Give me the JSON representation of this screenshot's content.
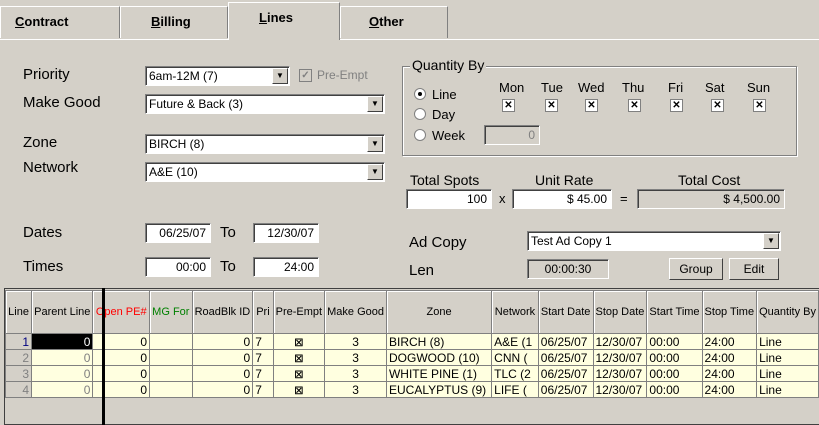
{
  "tabs": [
    {
      "label": "Contract",
      "u": "C",
      "rest": "ontract"
    },
    {
      "label": "Billing",
      "u": "B",
      "rest": "illing"
    },
    {
      "label": "Lines",
      "u": "L",
      "rest": "ines"
    },
    {
      "label": "Other",
      "u": "O",
      "rest": "ther"
    }
  ],
  "form": {
    "priority_label": "Priority",
    "priority_value": "6am-12M (7)",
    "preempt_label": "Pre-Empt",
    "makegood_label": "Make Good",
    "makegood_value": "Future & Back (3)",
    "zone_label": "Zone",
    "zone_value": "BIRCH (8)",
    "network_label": "Network",
    "network_value": "A&E (10)",
    "dates_label": "Dates",
    "date_start": "06/25/07",
    "to1": "To",
    "date_end": "12/30/07",
    "times_label": "Times",
    "time_start": "00:00",
    "to2": "To",
    "time_end": "24:00"
  },
  "quantity": {
    "title": "Quantity By",
    "options": [
      "Line",
      "Day",
      "Week"
    ],
    "selected": "Line",
    "days": [
      "Mon",
      "Tue",
      "Wed",
      "Thu",
      "Fri",
      "Sat",
      "Sun"
    ],
    "week_value": "0"
  },
  "totals": {
    "spots_label": "Total Spots",
    "spots_value": "100",
    "x": "x",
    "rate_label": "Unit Rate",
    "rate_value": "$ 45.00",
    "eq": "=",
    "cost_label": "Total Cost",
    "cost_value": "$ 4,500.00"
  },
  "adcopy": {
    "label": "Ad Copy",
    "value": "Test Ad Copy 1",
    "len_label": "Len",
    "len_value": "00:00:30",
    "group_button": "Group",
    "edit_button": "Edit"
  },
  "grid": {
    "headers": [
      "Line",
      "Parent Line",
      "Open PE#",
      "MG For",
      "RoadBlk ID",
      "Pri",
      "Pre-Empt",
      "Make Good",
      "Zone",
      "Network",
      "Start Date",
      "Stop Date",
      "Start Time",
      "Stop Time",
      "Quantity By"
    ],
    "header_colors": {
      "open_pe": "#ff0000",
      "mg_for": "#008000"
    },
    "rows": [
      [
        "1",
        "0",
        "0",
        "",
        "0",
        "7",
        "x",
        "3",
        "BIRCH (8)",
        "A&E (1",
        "06/25/07",
        "12/30/07",
        "00:00",
        "24:00",
        "Line"
      ],
      [
        "2",
        "0",
        "0",
        "",
        "0",
        "7",
        "x",
        "3",
        "DOGWOOD (10)",
        "CNN (",
        "06/25/07",
        "12/30/07",
        "00:00",
        "24:00",
        "Line"
      ],
      [
        "3",
        "0",
        "0",
        "",
        "0",
        "7",
        "x",
        "3",
        "WHITE PINE (1)",
        "TLC (2",
        "06/25/07",
        "12/30/07",
        "00:00",
        "24:00",
        "Line"
      ],
      [
        "4",
        "0",
        "0",
        "",
        "0",
        "7",
        "x",
        "3",
        "EUCALYPTUS (9)",
        "LIFE (",
        "06/25/07",
        "12/30/07",
        "00:00",
        "24:00",
        "Line"
      ]
    ]
  }
}
